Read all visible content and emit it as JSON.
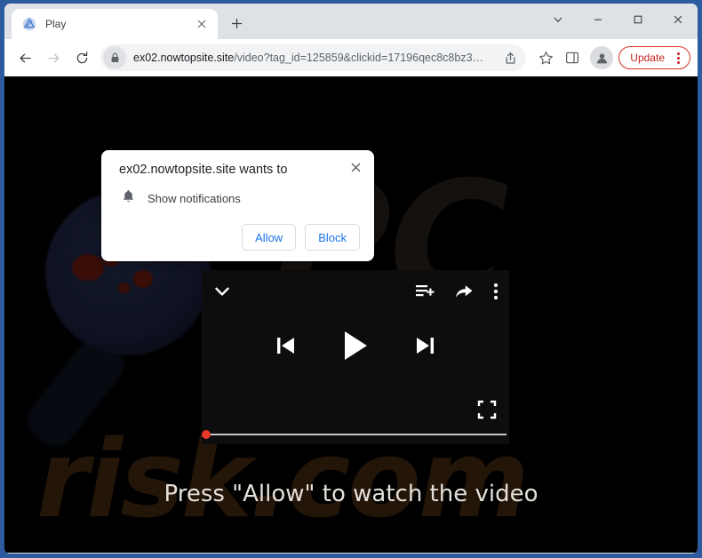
{
  "window": {
    "controls": [
      {
        "name": "tab-search",
        "glyph": "chevron-down"
      },
      {
        "name": "minimize",
        "glyph": "minimize"
      },
      {
        "name": "maximize",
        "glyph": "maximize"
      },
      {
        "name": "close",
        "glyph": "close"
      }
    ],
    "frame_color": "#2c5c9e"
  },
  "tabstrip": {
    "tab": {
      "title": "Play",
      "favicon": "play-site-favicon",
      "close_label": "×"
    },
    "new_tab_label": "+"
  },
  "toolbar": {
    "back_label": "←",
    "forward_label": "→",
    "reload_label": "reload",
    "omnibox": {
      "lock_icon": "lock-icon",
      "host": "ex02.nowtopsite.site",
      "path": "/video?tag_id=125859&clickid=17196qec8c8bz3…",
      "full_url": "ex02.nowtopsite.site/video?tag_id=125859&clickid=17196qec8c8bz3…",
      "share_icon": "share-icon"
    },
    "bookmark_icon": "star-icon",
    "side_panel_icon": "side-panel-icon",
    "profile_icon": "profile-avatar-icon",
    "update_label": "Update",
    "menu_icon": "three-dot-menu-icon",
    "update_color": "#c5221f"
  },
  "permission_dialog": {
    "title": "ex02.nowtopsite.site wants to",
    "permission_icon": "bell-icon",
    "permission_label": "Show notifications",
    "allow_label": "Allow",
    "block_label": "Block",
    "close_label": "×",
    "button_text_color": "#1a73e8"
  },
  "page": {
    "background_color": "#000000",
    "watermark_top": "PC",
    "watermark_bottom": "risk.com",
    "cta_text": "Press \"Allow\" to watch the video",
    "player": {
      "collapse_icon": "chevron-down-icon",
      "add_to_queue_icon": "playlist-add-icon",
      "share_icon": "share-arrow-icon",
      "more_icon": "more-vertical-icon",
      "previous_icon": "previous-track-icon",
      "play_icon": "play-icon",
      "next_icon": "next-track-icon",
      "fullscreen_icon": "fullscreen-icon",
      "progress_percent": 0,
      "progress_dot_color": "#e8362a",
      "track_color": "#c8c8c8"
    }
  }
}
